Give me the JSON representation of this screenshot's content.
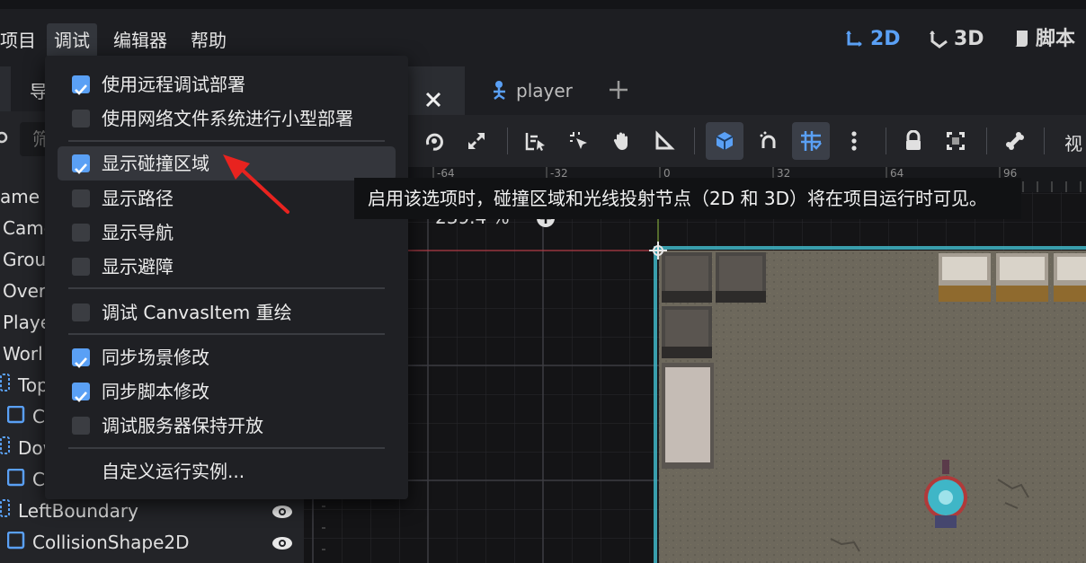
{
  "menubar": {
    "menus": [
      "项目",
      "调试",
      "编辑器",
      "帮助"
    ],
    "modes": {
      "mode_2d": "2D",
      "mode_3d": "3D",
      "script": "脚本"
    }
  },
  "left_dock": {
    "tab_label": "导",
    "filter_placeholder": "筛",
    "tree": [
      {
        "label": "ame"
      },
      {
        "label": "Came"
      },
      {
        "label": "Grou"
      },
      {
        "label": "Over"
      },
      {
        "label": "Playe"
      },
      {
        "label": "Worl"
      },
      {
        "label": "Top"
      },
      {
        "label": "C"
      },
      {
        "label": "Dow"
      },
      {
        "label": "C"
      },
      {
        "label": "LeftBoundary"
      },
      {
        "label": "CollisionShape2D"
      }
    ]
  },
  "scene_tabs": {
    "active": "",
    "player": "player"
  },
  "toolbar": {
    "view_label": "视"
  },
  "viewport": {
    "zoom": "239.4 %",
    "ruler": [
      "-64",
      "-32",
      "0",
      "32",
      "64",
      "96"
    ]
  },
  "debug_menu": {
    "items": [
      {
        "label": "使用远程调试部署",
        "checked": true
      },
      {
        "label": "使用网络文件系统进行小型部署",
        "checked": false
      },
      {
        "label": "显示碰撞区域",
        "checked": true
      },
      {
        "label": "显示路径",
        "checked": false
      },
      {
        "label": "显示导航",
        "checked": false
      },
      {
        "label": "显示避障",
        "checked": false
      },
      {
        "label": "调试 CanvasItem 重绘",
        "checked": false
      },
      {
        "label": "同步场景修改",
        "checked": true
      },
      {
        "label": "同步脚本修改",
        "checked": true
      },
      {
        "label": "调试服务器保持开放",
        "checked": false
      },
      {
        "label": "自定义运行实例..."
      }
    ]
  },
  "tooltip": "启用该选项时，碰撞区域和光线投射节点（2D 和 3D）将在项目运行时可见。",
  "colors": {
    "accent": "#5aa0f5",
    "arrow": "#e8231f",
    "collision": "#3fb6c7"
  }
}
